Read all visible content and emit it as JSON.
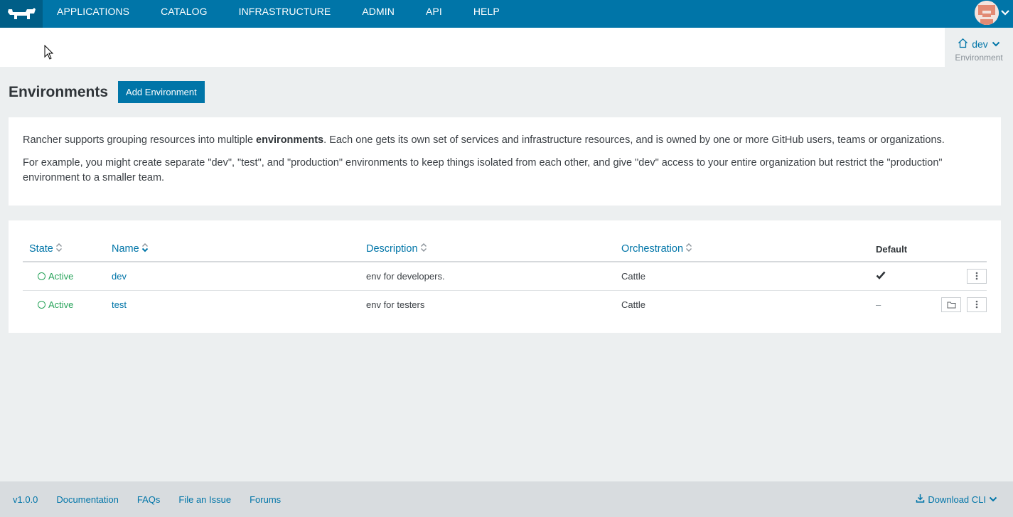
{
  "nav": {
    "items": [
      {
        "label": "APPLICATIONS"
      },
      {
        "label": "CATALOG"
      },
      {
        "label": "INFRASTRUCTURE"
      },
      {
        "label": "ADMIN"
      },
      {
        "label": "API"
      },
      {
        "label": "HELP"
      }
    ],
    "user_icon": "avatar-icon"
  },
  "environment_switcher": {
    "name": "dev",
    "label": "Environment"
  },
  "page": {
    "title": "Environments",
    "add_button": "Add Environment"
  },
  "info": {
    "p1_before": "Rancher supports grouping resources into multiple ",
    "p1_bold": "environments",
    "p1_after": ". Each one gets its own set of services and infrastructure resources, and is owned by one or more GitHub users, teams or organizations.",
    "p2": "For example, you might create separate \"dev\", \"test\", and \"production\" environments to keep things isolated from each other, and give \"dev\" access to your entire organization but restrict the \"production\" environment to a smaller team."
  },
  "table": {
    "columns": {
      "state": "State",
      "name": "Name",
      "description": "Description",
      "orchestration": "Orchestration",
      "default": "Default"
    },
    "rows": [
      {
        "state": "Active",
        "name": "dev",
        "description": "env for developers.",
        "orchestration": "Cattle",
        "default": "check-icon"
      },
      {
        "state": "Active",
        "name": "test",
        "description": "env for testers",
        "orchestration": "Cattle",
        "default": "–"
      }
    ]
  },
  "footer": {
    "version": "v1.0.0",
    "documentation": "Documentation",
    "faqs": "FAQs",
    "file_issue": "File an Issue",
    "forums": "Forums",
    "download_cli": "Download CLI"
  },
  "colors": {
    "brand": "#0075a8",
    "active": "#27a35a",
    "background": "#eceff0"
  }
}
